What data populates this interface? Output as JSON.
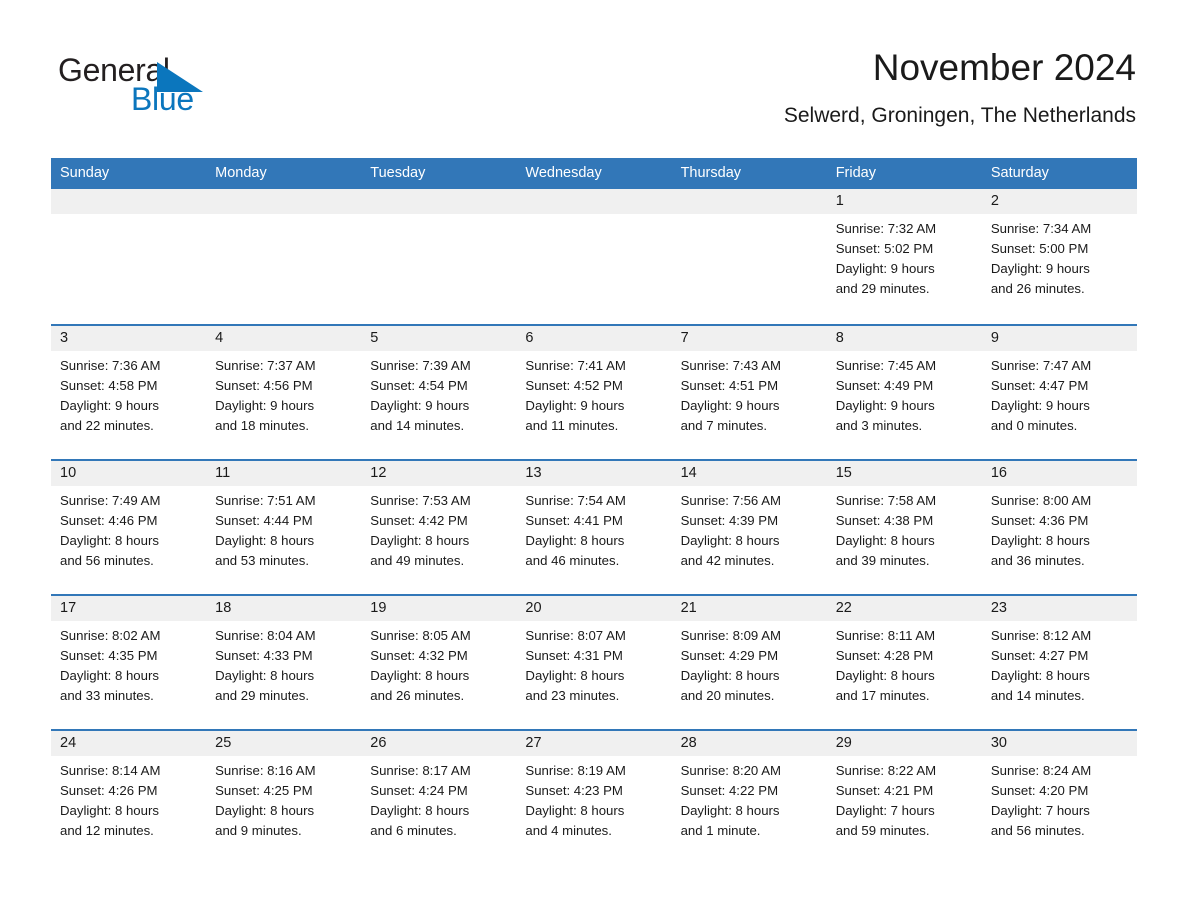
{
  "logo": {
    "word_one": "General",
    "word_two": "Blue",
    "triangle_color": "#0b76bd"
  },
  "header": {
    "title": "November 2024",
    "subtitle": "Selwerd, Groningen, The Netherlands"
  },
  "theme": {
    "header_blue": "#3277b8",
    "day_band_gray": "#f0f0f0",
    "text": "#1a1a1a",
    "header_text": "#ffffff"
  },
  "calendar": {
    "weekday_headers": [
      "Sunday",
      "Monday",
      "Tuesday",
      "Wednesday",
      "Thursday",
      "Friday",
      "Saturday"
    ],
    "weeks": [
      [
        {
          "day": "",
          "lines": []
        },
        {
          "day": "",
          "lines": []
        },
        {
          "day": "",
          "lines": []
        },
        {
          "day": "",
          "lines": []
        },
        {
          "day": "",
          "lines": []
        },
        {
          "day": "1",
          "lines": [
            "Sunrise: 7:32 AM",
            "Sunset: 5:02 PM",
            "Daylight: 9 hours",
            "and 29 minutes."
          ]
        },
        {
          "day": "2",
          "lines": [
            "Sunrise: 7:34 AM",
            "Sunset: 5:00 PM",
            "Daylight: 9 hours",
            "and 26 minutes."
          ]
        }
      ],
      [
        {
          "day": "3",
          "lines": [
            "Sunrise: 7:36 AM",
            "Sunset: 4:58 PM",
            "Daylight: 9 hours",
            "and 22 minutes."
          ]
        },
        {
          "day": "4",
          "lines": [
            "Sunrise: 7:37 AM",
            "Sunset: 4:56 PM",
            "Daylight: 9 hours",
            "and 18 minutes."
          ]
        },
        {
          "day": "5",
          "lines": [
            "Sunrise: 7:39 AM",
            "Sunset: 4:54 PM",
            "Daylight: 9 hours",
            "and 14 minutes."
          ]
        },
        {
          "day": "6",
          "lines": [
            "Sunrise: 7:41 AM",
            "Sunset: 4:52 PM",
            "Daylight: 9 hours",
            "and 11 minutes."
          ]
        },
        {
          "day": "7",
          "lines": [
            "Sunrise: 7:43 AM",
            "Sunset: 4:51 PM",
            "Daylight: 9 hours",
            "and 7 minutes."
          ]
        },
        {
          "day": "8",
          "lines": [
            "Sunrise: 7:45 AM",
            "Sunset: 4:49 PM",
            "Daylight: 9 hours",
            "and 3 minutes."
          ]
        },
        {
          "day": "9",
          "lines": [
            "Sunrise: 7:47 AM",
            "Sunset: 4:47 PM",
            "Daylight: 9 hours",
            "and 0 minutes."
          ]
        }
      ],
      [
        {
          "day": "10",
          "lines": [
            "Sunrise: 7:49 AM",
            "Sunset: 4:46 PM",
            "Daylight: 8 hours",
            "and 56 minutes."
          ]
        },
        {
          "day": "11",
          "lines": [
            "Sunrise: 7:51 AM",
            "Sunset: 4:44 PM",
            "Daylight: 8 hours",
            "and 53 minutes."
          ]
        },
        {
          "day": "12",
          "lines": [
            "Sunrise: 7:53 AM",
            "Sunset: 4:42 PM",
            "Daylight: 8 hours",
            "and 49 minutes."
          ]
        },
        {
          "day": "13",
          "lines": [
            "Sunrise: 7:54 AM",
            "Sunset: 4:41 PM",
            "Daylight: 8 hours",
            "and 46 minutes."
          ]
        },
        {
          "day": "14",
          "lines": [
            "Sunrise: 7:56 AM",
            "Sunset: 4:39 PM",
            "Daylight: 8 hours",
            "and 42 minutes."
          ]
        },
        {
          "day": "15",
          "lines": [
            "Sunrise: 7:58 AM",
            "Sunset: 4:38 PM",
            "Daylight: 8 hours",
            "and 39 minutes."
          ]
        },
        {
          "day": "16",
          "lines": [
            "Sunrise: 8:00 AM",
            "Sunset: 4:36 PM",
            "Daylight: 8 hours",
            "and 36 minutes."
          ]
        }
      ],
      [
        {
          "day": "17",
          "lines": [
            "Sunrise: 8:02 AM",
            "Sunset: 4:35 PM",
            "Daylight: 8 hours",
            "and 33 minutes."
          ]
        },
        {
          "day": "18",
          "lines": [
            "Sunrise: 8:04 AM",
            "Sunset: 4:33 PM",
            "Daylight: 8 hours",
            "and 29 minutes."
          ]
        },
        {
          "day": "19",
          "lines": [
            "Sunrise: 8:05 AM",
            "Sunset: 4:32 PM",
            "Daylight: 8 hours",
            "and 26 minutes."
          ]
        },
        {
          "day": "20",
          "lines": [
            "Sunrise: 8:07 AM",
            "Sunset: 4:31 PM",
            "Daylight: 8 hours",
            "and 23 minutes."
          ]
        },
        {
          "day": "21",
          "lines": [
            "Sunrise: 8:09 AM",
            "Sunset: 4:29 PM",
            "Daylight: 8 hours",
            "and 20 minutes."
          ]
        },
        {
          "day": "22",
          "lines": [
            "Sunrise: 8:11 AM",
            "Sunset: 4:28 PM",
            "Daylight: 8 hours",
            "and 17 minutes."
          ]
        },
        {
          "day": "23",
          "lines": [
            "Sunrise: 8:12 AM",
            "Sunset: 4:27 PM",
            "Daylight: 8 hours",
            "and 14 minutes."
          ]
        }
      ],
      [
        {
          "day": "24",
          "lines": [
            "Sunrise: 8:14 AM",
            "Sunset: 4:26 PM",
            "Daylight: 8 hours",
            "and 12 minutes."
          ]
        },
        {
          "day": "25",
          "lines": [
            "Sunrise: 8:16 AM",
            "Sunset: 4:25 PM",
            "Daylight: 8 hours",
            "and 9 minutes."
          ]
        },
        {
          "day": "26",
          "lines": [
            "Sunrise: 8:17 AM",
            "Sunset: 4:24 PM",
            "Daylight: 8 hours",
            "and 6 minutes."
          ]
        },
        {
          "day": "27",
          "lines": [
            "Sunrise: 8:19 AM",
            "Sunset: 4:23 PM",
            "Daylight: 8 hours",
            "and 4 minutes."
          ]
        },
        {
          "day": "28",
          "lines": [
            "Sunrise: 8:20 AM",
            "Sunset: 4:22 PM",
            "Daylight: 8 hours",
            "and 1 minute."
          ]
        },
        {
          "day": "29",
          "lines": [
            "Sunrise: 8:22 AM",
            "Sunset: 4:21 PM",
            "Daylight: 7 hours",
            "and 59 minutes."
          ]
        },
        {
          "day": "30",
          "lines": [
            "Sunrise: 8:24 AM",
            "Sunset: 4:20 PM",
            "Daylight: 7 hours",
            "and 56 minutes."
          ]
        }
      ]
    ]
  }
}
